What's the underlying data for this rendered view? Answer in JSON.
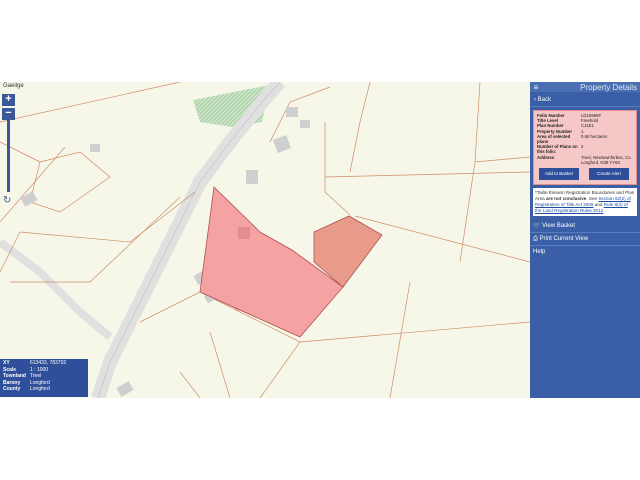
{
  "map": {
    "language_toggle": "Gaeilge",
    "zoom_in": "+",
    "zoom_out": "−",
    "refresh_icon": "↻",
    "info": [
      {
        "key": "XY",
        "value": "613433, 783702"
      },
      {
        "key": "Scale",
        "value": "1 : 1000"
      },
      {
        "key": "Townland",
        "value": "Treel"
      },
      {
        "key": "Barony",
        "value": "Longford"
      },
      {
        "key": "County",
        "value": "Longford"
      }
    ],
    "colors": {
      "selected_parcel": "#f4a2a2",
      "adjacent_parcel": "#e99b8a",
      "lines": "#d08c6a",
      "road": "#dcdcdc"
    }
  },
  "panel": {
    "menu_icon": "≡",
    "title": "Property Details",
    "back_label": "Back",
    "details": [
      {
        "key": "Folio Number",
        "value": "LD15969F"
      },
      {
        "key": "Title Level",
        "value": "Freehold"
      },
      {
        "key": "Plan Number",
        "value": "CJ1E1"
      },
      {
        "key": "Property Number",
        "value": "1"
      },
      {
        "key": "Area of selected plans",
        "value": "0.60 hectares"
      },
      {
        "key": "Number of Plans on this folio:",
        "value": "2"
      },
      {
        "key": "Address",
        "value": "Treel, Newtownforbes, Co. Longford, N39 YY83"
      }
    ],
    "add_to_basket": "Add to Basket",
    "create_alert": "Create Alert",
    "note": {
      "text1": "*Tailte Éireann Registration Boundaries and Plan Area",
      "bold": "are not conclusive",
      "text2": ". See",
      "link1": "Section 62(2) of Registration of Title Act 2006",
      "text3": "and",
      "link2": "Rule 8(3) of the Land Registration Rules 2012"
    },
    "view_basket": "View Basket",
    "print_view": "Print Current View",
    "help": "Help"
  }
}
